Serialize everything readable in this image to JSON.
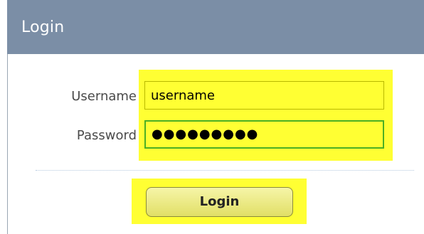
{
  "header": {
    "title": "Login"
  },
  "form": {
    "username_label": "Username",
    "username_value": "username",
    "password_label": "Password",
    "password_value": "●●●●●●●●●",
    "login_button_label": "Login"
  },
  "colors": {
    "header_bg": "#7b8ea6",
    "highlight": "#ffff33",
    "focus_border": "#4caf24"
  }
}
